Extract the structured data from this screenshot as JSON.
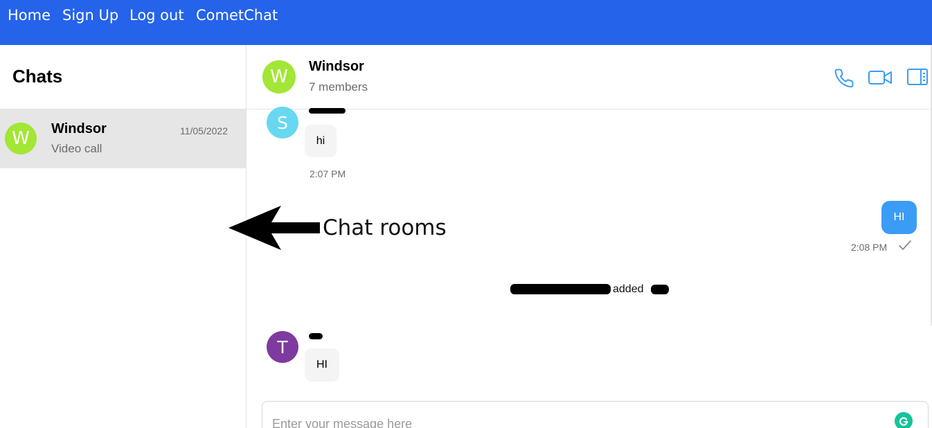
{
  "nav": {
    "links": [
      "Home",
      "Sign Up",
      "Log out",
      "CometChat"
    ]
  },
  "sidebar": {
    "title": "Chats",
    "conversations": [
      {
        "avatar_letter": "W",
        "name": "Windsor",
        "date": "11/05/2022",
        "last_message": "Video call",
        "avatar_color": "#a3e635"
      }
    ]
  },
  "annotation": {
    "label": "Chat rooms"
  },
  "chat": {
    "avatar_letter": "W",
    "title": "Windsor",
    "subtitle": "7 members",
    "header_icons": [
      "phone-icon",
      "video-camera-icon",
      "details-panel-icon"
    ]
  },
  "messages": [
    {
      "direction": "incoming",
      "avatar_letter": "S",
      "avatar_color": "#67d8f0",
      "text": "hi",
      "time": "2:07 PM"
    },
    {
      "direction": "outgoing",
      "text": "HI",
      "time": "2:08 PM",
      "status": "check-icon"
    },
    {
      "direction": "system",
      "text": "added"
    },
    {
      "direction": "incoming",
      "avatar_letter": "T",
      "avatar_color": "#7e3a9e",
      "text": "HI"
    }
  ],
  "composer": {
    "placeholder": "Enter your message here"
  },
  "colors": {
    "nav_bg": "#2563eb",
    "accent": "#3b9cf5",
    "selected_row": "#e6e6e6"
  }
}
